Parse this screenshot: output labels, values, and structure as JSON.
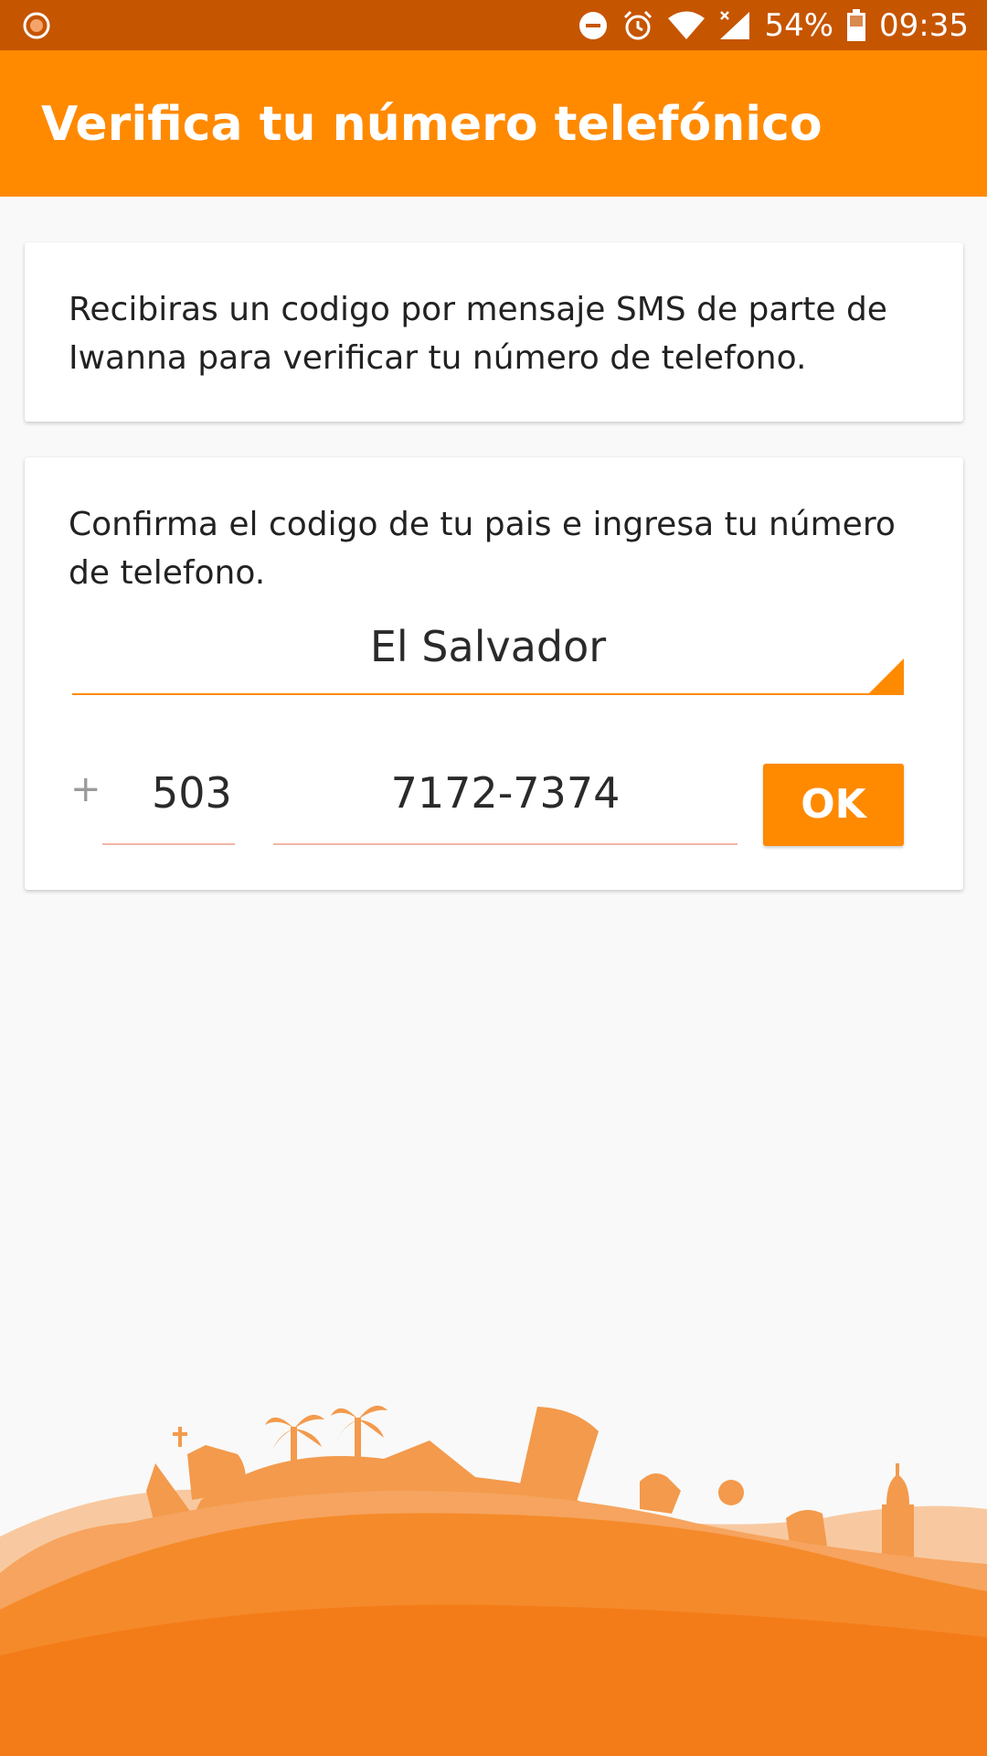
{
  "status_bar": {
    "battery": "54%",
    "time": "09:35",
    "icons": [
      "record-icon",
      "do-not-disturb-icon",
      "alarm-icon",
      "wifi-icon",
      "signal-icon",
      "battery-icon"
    ]
  },
  "header": {
    "title": "Verifica tu número telefónico"
  },
  "info_card": {
    "text": "Recibiras un codigo por mensaje SMS de parte de Iwanna para verificar tu número de telefono."
  },
  "phone_card": {
    "instruction": "Confirma el codigo de tu pais e ingresa tu número de telefono.",
    "country": "El Salvador",
    "plus": "+",
    "country_code": "503",
    "phone_number": "7172-7374",
    "ok_label": "OK"
  },
  "colors": {
    "status_bar": "#c65500",
    "app_bar": "#ff8a00",
    "accent": "#ff8a00",
    "background": "#f9f9f9",
    "landscape_dark": "#f47c18",
    "landscape_light": "#f8c9a0"
  }
}
